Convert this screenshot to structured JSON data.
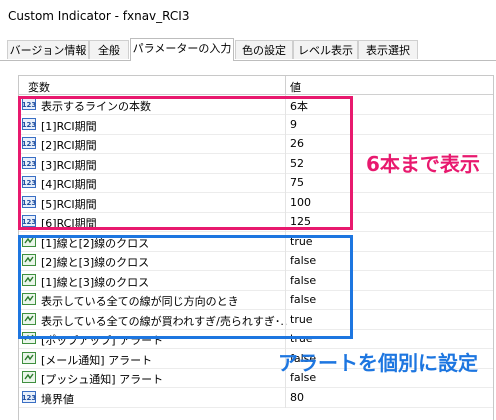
{
  "window": {
    "title": "Custom Indicator - fxnav_RCI3"
  },
  "tabs": [
    {
      "label": "バージョン情報"
    },
    {
      "label": "全般"
    },
    {
      "label": "パラメーターの入力"
    },
    {
      "label": "色の設定"
    },
    {
      "label": "レベル表示"
    },
    {
      "label": "表示選択"
    }
  ],
  "table": {
    "headers": {
      "name": "変数",
      "value": "値"
    },
    "rows": [
      {
        "icon": "123",
        "name": "表示するラインの本数",
        "value": "6本"
      },
      {
        "icon": "123",
        "name": "[1]RCI期間",
        "value": "9"
      },
      {
        "icon": "123",
        "name": "[2]RCI期間",
        "value": "26"
      },
      {
        "icon": "123",
        "name": "[3]RCI期間",
        "value": "52"
      },
      {
        "icon": "123",
        "name": "[4]RCI期間",
        "value": "75"
      },
      {
        "icon": "123",
        "name": "[5]RCI期間",
        "value": "100"
      },
      {
        "icon": "123",
        "name": "[6]RCI期間",
        "value": "125"
      },
      {
        "icon": "bool",
        "name": "[1]線と[2]線のクロス",
        "value": "true"
      },
      {
        "icon": "bool",
        "name": "[2]線と[3]線のクロス",
        "value": "false"
      },
      {
        "icon": "bool",
        "name": "[1]線と[3]線のクロス",
        "value": "false"
      },
      {
        "icon": "bool",
        "name": "表示している全ての線が同じ方向のとき",
        "value": "false"
      },
      {
        "icon": "bool",
        "name": "表示している全ての線が買われすぎ/売られすぎ･..",
        "value": "true"
      },
      {
        "icon": "bool",
        "name": "[ポップアップ] アラート",
        "value": "true"
      },
      {
        "icon": "bool",
        "name": "[メール通知] アラート",
        "value": "false"
      },
      {
        "icon": "bool",
        "name": "[プッシュ通知] アラート",
        "value": "false"
      },
      {
        "icon": "123",
        "name": "境界値",
        "value": "80"
      }
    ]
  },
  "annotations": {
    "label1": "6本まで表示",
    "label2": "アラートを個別に設定",
    "color1": "#e8196e",
    "color2": "#1d76e0"
  }
}
